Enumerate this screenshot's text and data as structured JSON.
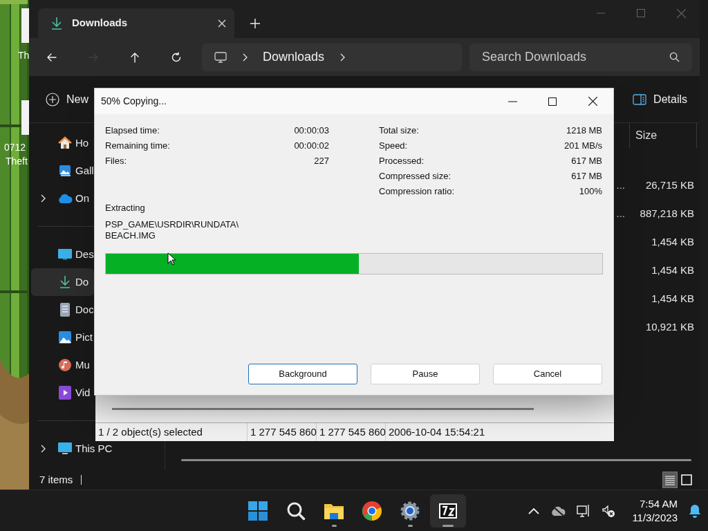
{
  "desktop": {
    "labels": [
      "Th",
      "0712",
      "Theft"
    ]
  },
  "explorer": {
    "tab": {
      "title": "Downloads"
    },
    "nav": [
      {
        "kind": "back",
        "disabled": false
      },
      {
        "kind": "forward",
        "disabled": true
      },
      {
        "kind": "up",
        "disabled": false
      },
      {
        "kind": "refresh",
        "disabled": false
      }
    ],
    "address": {
      "crumbs": [
        "Downloads"
      ]
    },
    "search": {
      "placeholder": "Search Downloads"
    },
    "toolbar": {
      "new": "New",
      "details": "Details"
    },
    "sidebar": {
      "groups": [
        [
          {
            "label": "Ho",
            "kind": "home",
            "expandable": false,
            "selected": false
          },
          {
            "label": "Gall",
            "kind": "gallery",
            "expandable": false,
            "selected": false
          },
          {
            "label": "On",
            "kind": "cloud",
            "expandable": true,
            "selected": false
          }
        ],
        [
          {
            "label": "Des",
            "kind": "desktop",
            "expandable": false,
            "selected": false
          },
          {
            "label": "Do",
            "kind": "download",
            "expandable": false,
            "selected": true
          },
          {
            "label": "Doc",
            "kind": "document",
            "expandable": false,
            "selected": false
          },
          {
            "label": "Pict",
            "kind": "pictures",
            "expandable": false,
            "selected": false
          },
          {
            "label": "Mu",
            "kind": "music",
            "expandable": false,
            "selected": false
          },
          {
            "label": "Vid",
            "kind": "video",
            "expandable": false,
            "selected": false
          }
        ],
        [
          {
            "label": "This PC",
            "kind": "pc",
            "expandable": true,
            "selected": false
          }
        ]
      ]
    },
    "column": "Size",
    "rows": [
      {
        "name_tail": "...",
        "size": "26,715 KB"
      },
      {
        "name_tail": "...",
        "size": "887,218 KB"
      },
      {
        "size": "1,454 KB"
      },
      {
        "size": "1,454 KB"
      },
      {
        "size": "1,454 KB"
      },
      {
        "size": "10,921 KB"
      }
    ],
    "status": "7 items",
    "views": [
      {
        "kind": "details",
        "selected": true
      },
      {
        "kind": "tiles",
        "selected": false
      }
    ]
  },
  "archive_window": {
    "status_cells": [
      "1 / 2 object(s) selected",
      "1 277 545 860",
      "1 277 545 860",
      "2006-10-04 15:54:21"
    ]
  },
  "dialog": {
    "title": "50% Copying...",
    "left_stats": [
      {
        "label": "Elapsed time:",
        "value": "00:00:03"
      },
      {
        "label": "Remaining time:",
        "value": "00:00:02"
      },
      {
        "label": "Files:",
        "value": "227"
      }
    ],
    "right_stats": [
      {
        "label": "Total size:",
        "value": "1218 MB"
      },
      {
        "label": "Speed:",
        "value": "201 MB/s"
      },
      {
        "label": "Processed:",
        "value": "617 MB"
      },
      {
        "label": "Compressed size:",
        "value": "617 MB"
      },
      {
        "label": "Compression ratio:",
        "value": "100%"
      }
    ],
    "operation": "Extracting",
    "path_lines": [
      "PSP_GAME\\USRDIR\\RUNDATA\\",
      "BEACH.IMG"
    ],
    "progress": {
      "level": 0.51
    },
    "buttons": [
      {
        "label": "Background",
        "default": true
      },
      {
        "label": "Pause",
        "default": false
      },
      {
        "label": "Cancel",
        "default": false
      }
    ]
  },
  "taskbar": {
    "apps": [
      {
        "kind": "start",
        "running": false,
        "active": false
      },
      {
        "kind": "search",
        "running": false,
        "active": false
      },
      {
        "kind": "explorer",
        "running": true,
        "active": false
      },
      {
        "kind": "chrome",
        "running": false,
        "active": false
      },
      {
        "kind": "settings",
        "running": true,
        "active": false
      },
      {
        "kind": "sevenzip",
        "running": true,
        "active": true
      }
    ],
    "time": "7:54 AM",
    "date": "11/3/2023"
  }
}
